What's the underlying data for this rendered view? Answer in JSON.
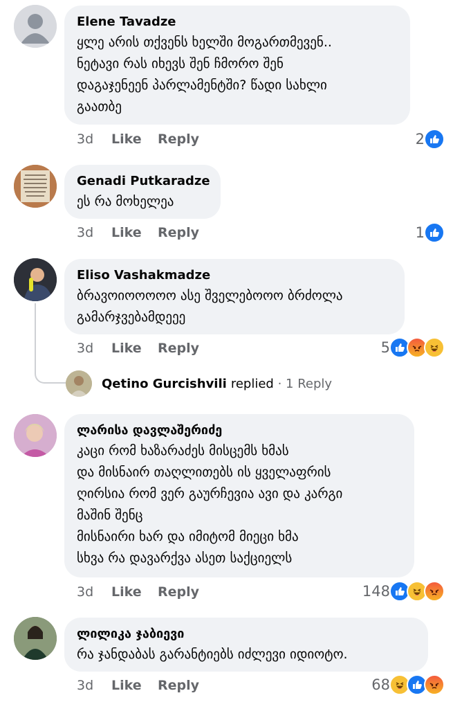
{
  "common": {
    "time": "3d",
    "like": "Like",
    "reply": "Reply"
  },
  "comments": [
    {
      "author": "Elene Tavadze",
      "text": "ყლე არის თქვენს ხელში მოგართმევენ..\nნეტავი რას იხევს შენ ჩმორო შენ\nდაგაჯენეენ პარლამენტში? წადი სახლი\nგაათბე",
      "reaction_count": "2",
      "reactions": [
        "like-icon"
      ]
    },
    {
      "author": "Genadi Putkaradze",
      "text": "ეს რა მოხელეა",
      "reaction_count": "1",
      "reactions": [
        "like-icon"
      ]
    },
    {
      "author": "Eliso Vashakmadze",
      "text": "ბრავოიოოოოო ასე შველებოოო ბრძოლა\nგამარჯვებამდეეე",
      "reaction_count": "5",
      "reactions": [
        "like-icon",
        "angry-icon",
        "haha-icon"
      ]
    },
    {
      "author": "ლარისა დავლაშერიძე",
      "text": "კაცი რომ ხაზარაძეს მისცემს ხმას\nდა მისნაირ თაღლითებს ის ყველაფრის\nღირსია რომ ვერ გაურჩევია ავი და კარგი\nმაშინ შენც\nმისნაირი ხარ და იმიტომ მიეცი ხმა\nსხვა რა დავარქვა ასეთ საქციელს",
      "reaction_count": "148",
      "reactions": [
        "like-icon",
        "haha-icon",
        "angry-icon"
      ]
    },
    {
      "author": "ლილიკა ჯაბიევი",
      "text": "რა ჯანდაბას გარანტიებს იძლევი იდიოტო.",
      "reaction_count": "68",
      "reactions": [
        "haha-icon",
        "like-icon",
        "angry-icon"
      ]
    }
  ],
  "reply_summary": {
    "name": "Qetino Gurcishvili",
    "verb": "replied",
    "separator": "·",
    "count_label": "1 Reply"
  },
  "colors": {
    "like": "#1877f2",
    "haha": "#f7c035",
    "angry": "#f45b3d",
    "bubble": "#f0f2f5",
    "meta": "#65676b"
  }
}
